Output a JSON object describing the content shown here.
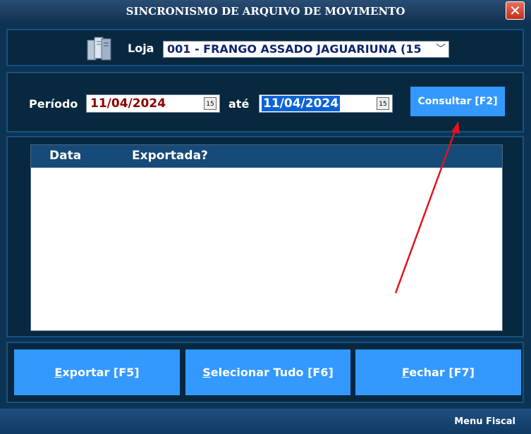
{
  "window": {
    "title": "SINCRONISMO DE ARQUIVO DE MOVIMENTO",
    "close_label": "✕"
  },
  "loja": {
    "label": "Loja",
    "selected": "001 - FRANGO ASSADO JAGUARIUNA (15",
    "icon": "server-icon"
  },
  "periodo": {
    "label": "Período",
    "from": "11/04/2024",
    "to_label": "até",
    "to": "11/04/2024",
    "calendar_icon_text": "15",
    "consultar_label": "Consultar [F2]"
  },
  "grid": {
    "columns": [
      "Data",
      "Exportada?"
    ],
    "rows": []
  },
  "footer": {
    "exportar": {
      "hotkey": "E",
      "rest": "xportar [F5]"
    },
    "selecionar": {
      "hotkey": "S",
      "rest": "elecionar Tudo [F6]"
    },
    "fechar": {
      "hotkey": "F",
      "rest": "echar [F7]"
    }
  },
  "status": {
    "menu_fiscal": "Menu Fiscal"
  },
  "colors": {
    "accent_button": "#3399ff",
    "background": "#0d3354",
    "annotation_arrow": "#e0141e"
  }
}
